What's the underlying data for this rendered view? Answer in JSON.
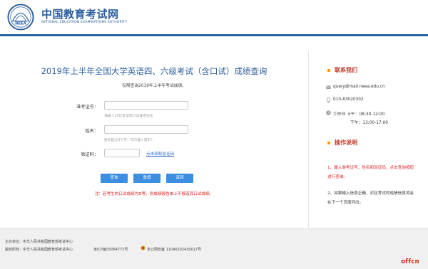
{
  "header": {
    "logo_cn": "中国教育考试网",
    "logo_en": "NATIONAL EDUCATION EXAMINATIONS AUTHORITY",
    "emblem_text": "NEEA"
  },
  "form": {
    "title": "2019年上半年全国大学英语四、六级考试（含口试）成绩查询",
    "subtitle": "仅限查询2019年上半年考试成绩。",
    "ticket_label": "准考证号：",
    "ticket_value": "",
    "ticket_hint": "请输入15位笔试或口试准考证号",
    "name_label": "姓名：",
    "name_value": "",
    "name_hint": "姓名超过3个字，可只输入前3个",
    "captcha_label": "验证码：",
    "captcha_value": "",
    "captcha_link": "点击获取验证码",
    "buttons": {
      "query": "查询",
      "reset": "重填",
      "back": "返回"
    },
    "notice": "注：若考生的口试成绩为D等，则成绩报告单上不报道其口试成绩。"
  },
  "side": {
    "contact_title": "联系我们",
    "email": "query@mail.neea.edu.cn",
    "phone": "010-83020302",
    "hours_am": "工作日 上午：08:30-12:00",
    "hours_pm": "下午：13:00-17:00",
    "guide_title": "操作说明",
    "guide_1": "1、输入准考证号、姓名和验证码，点击查询按钮进行查询。",
    "guide_2": "2、如果输入信息正确，对应考试的成绩信息将会在下一个页面列出。",
    "accent_color": "#f39c12",
    "title_color": "#c0392b"
  },
  "footer": {
    "host": "主办单位：中华人民共和国教育部考试中心",
    "copyright": "版权所有：中华人民共和国教育部考试中心",
    "icp": "京ICP备05064772号",
    "police": "京公网安备 11040202430017号"
  },
  "watermark": "offcn"
}
